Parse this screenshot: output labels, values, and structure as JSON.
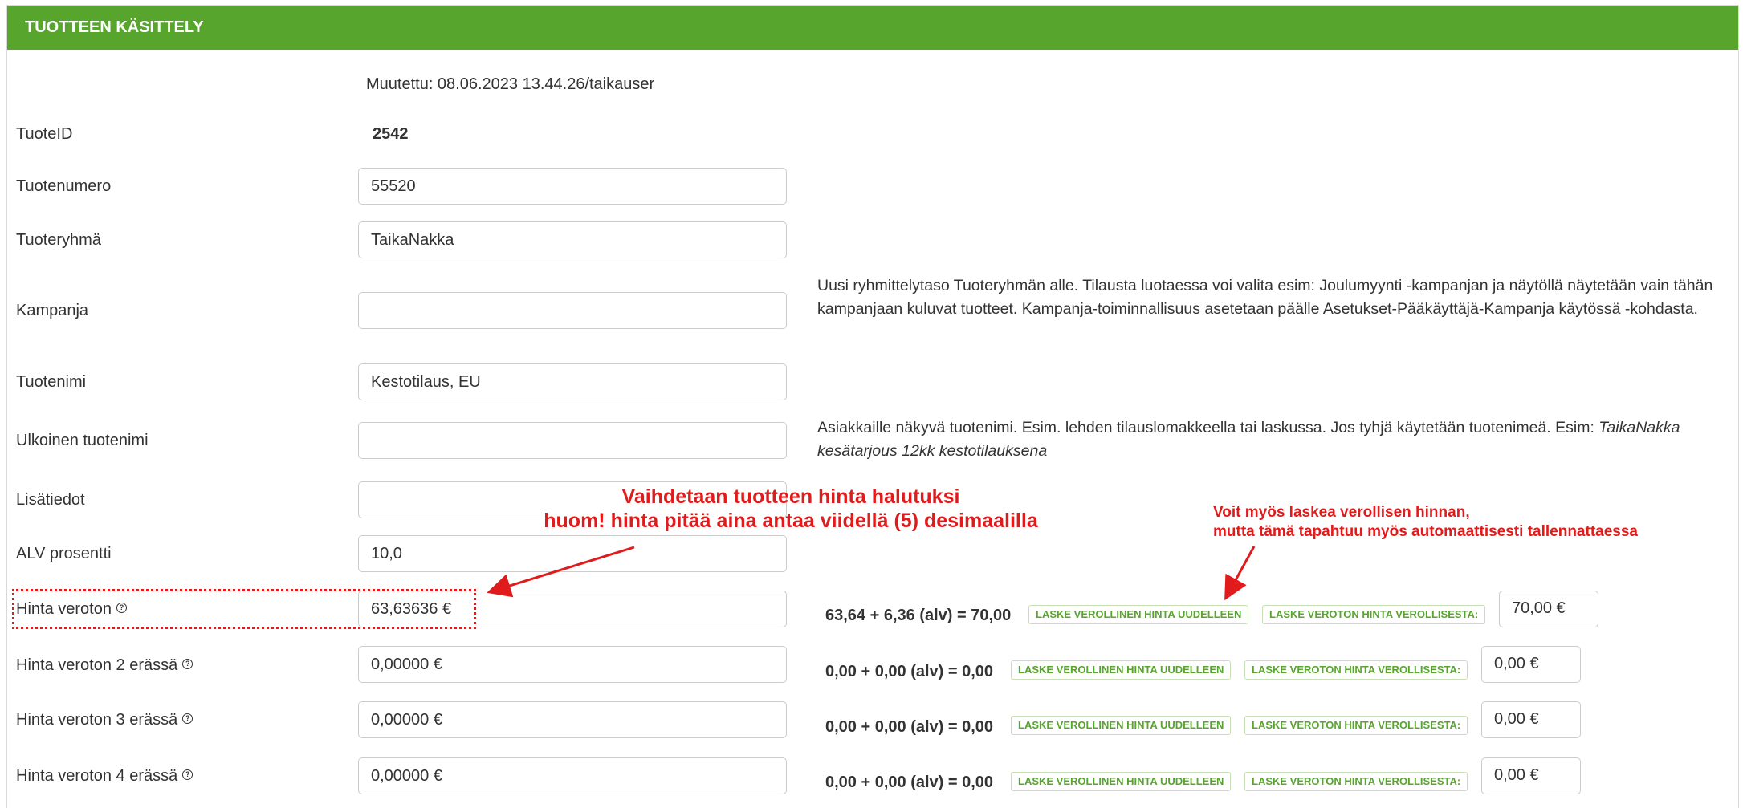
{
  "header": {
    "title": "TUOTTEEN KÄSITTELY"
  },
  "modified": "Muutettu: 08.06.2023 13.44.26/taikauser",
  "fields": {
    "tuoteid": {
      "label": "TuoteID",
      "value": "2542"
    },
    "tuotenumero": {
      "label": "Tuotenumero",
      "value": "55520"
    },
    "tuoteryhma": {
      "label": "Tuoteryhmä",
      "value": "TaikaNakka"
    },
    "kampanja": {
      "label": "Kampanja",
      "value": ""
    },
    "tuotenimi": {
      "label": "Tuotenimi",
      "value": "Kestotilaus, EU"
    },
    "ulkoinen": {
      "label": "Ulkoinen tuotenimi",
      "value": ""
    },
    "lisatiedot": {
      "label": "Lisätiedot",
      "value": ""
    },
    "alv": {
      "label": "ALV prosentti",
      "value": "10,0"
    }
  },
  "help": {
    "kampanja": "Uusi ryhmittelytaso Tuoteryhmän alle. Tilausta luotaessa voi valita esim: Joulumyynti -kampanjan ja näytöllä näytetään vain tähän kampanjaan kuluvat tuotteet. Kampanja-toiminnallisuus asetetaan päälle Asetukset-Pääkäyttäjä-Kampanja käytössä -kohdasta.",
    "ulkoinen_text": "Asiakkaille näkyvä tuotenimi. Esim. lehden tilauslomakkeella tai laskussa. Jos tyhjä käytetään tuotenimeä. Esim: ",
    "ulkoinen_example": "TaikaNakka kesätarjous 12kk kestotilauksena"
  },
  "prices": [
    {
      "label": "Hinta veroton",
      "help_icon": "?",
      "value": "63,63636 €",
      "calc": "63,64 + 6,36 (alv) = 70,00",
      "btn_gross": "LASKE VEROLLINEN HINTA UUDELLEEN",
      "btn_net": "LASKE VEROTON HINTA VEROLLISESTA:",
      "gross": "70,00 €"
    },
    {
      "label": "Hinta veroton 2 erässä",
      "help_icon": "?",
      "value": "0,00000 €",
      "calc": "0,00 + 0,00 (alv) = 0,00",
      "btn_gross": "LASKE VEROLLINEN HINTA UUDELLEEN",
      "btn_net": "LASKE VEROTON HINTA VEROLLISESTA:",
      "gross": "0,00 €"
    },
    {
      "label": "Hinta veroton 3 erässä",
      "help_icon": "?",
      "value": "0,00000 €",
      "calc": "0,00 + 0,00 (alv) = 0,00",
      "btn_gross": "LASKE VEROLLINEN HINTA UUDELLEEN",
      "btn_net": "LASKE VEROTON HINTA VEROLLISESTA:",
      "gross": "0,00 €"
    },
    {
      "label": "Hinta veroton 4 erässä",
      "help_icon": "?",
      "value": "0,00000 €",
      "calc": "0,00 + 0,00 (alv) = 0,00",
      "btn_gross": "LASKE VEROLLINEN HINTA UUDELLEEN",
      "btn_net": "LASKE VEROTON HINTA VEROLLISESTA:",
      "gross": "0,00 €"
    }
  ],
  "annotations": {
    "main_line1": "Vaihdetaan tuotteen hinta halutuksi",
    "main_line2": "huom! hinta pitää aina antaa viidellä (5) desimaalilla",
    "side_line1": "Voit myös laskea verollisen hinnan,",
    "side_line2": "mutta tämä tapahtuu myös automaattisesti tallennattaessa"
  },
  "colors": {
    "header_bg": "#58a52e",
    "accent_green": "#58a52e",
    "annotation_red": "#e01b1b"
  }
}
